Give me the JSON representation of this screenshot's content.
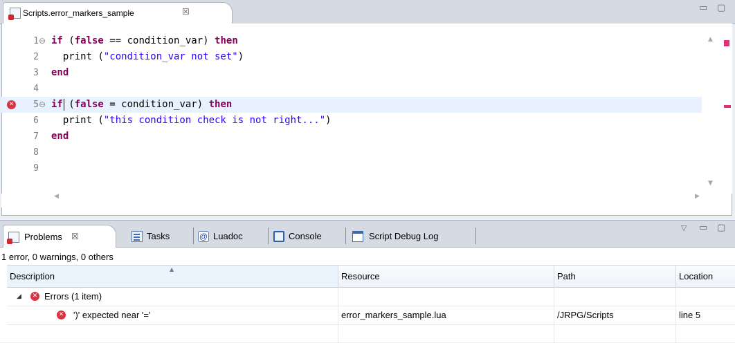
{
  "editor": {
    "tab_title": "Scripts.error_markers_sample",
    "tab_close": "☒",
    "lines": [
      {
        "num": "1",
        "fold": true,
        "tokens": [
          {
            "t": "if",
            "c": "kw"
          },
          {
            "t": " (",
            "c": ""
          },
          {
            "t": "false",
            "c": "kw"
          },
          {
            "t": " == condition_var) ",
            "c": ""
          },
          {
            "t": "then",
            "c": "kw"
          }
        ]
      },
      {
        "num": "2",
        "fold": false,
        "tokens": [
          {
            "t": "  print (",
            "c": ""
          },
          {
            "t": "\"condition_var not set\"",
            "c": "str"
          },
          {
            "t": ")",
            "c": ""
          }
        ]
      },
      {
        "num": "3",
        "fold": false,
        "tokens": [
          {
            "t": "end",
            "c": "kw"
          }
        ]
      },
      {
        "num": "4",
        "fold": false,
        "tokens": []
      },
      {
        "num": "5",
        "fold": true,
        "error": true,
        "highlight": true,
        "tokens": [
          {
            "t": "if",
            "c": "kw"
          },
          {
            "t": " (",
            "c": ""
          },
          {
            "t": "false",
            "c": "kw"
          },
          {
            "t": " = condition_var) ",
            "c": ""
          },
          {
            "t": "then",
            "c": "kw"
          }
        ]
      },
      {
        "num": "6",
        "fold": false,
        "tokens": [
          {
            "t": "  print (",
            "c": ""
          },
          {
            "t": "\"this condition check is not right...\"",
            "c": "str"
          },
          {
            "t": ")",
            "c": ""
          }
        ]
      },
      {
        "num": "7",
        "fold": false,
        "tokens": [
          {
            "t": "end",
            "c": "kw"
          }
        ]
      },
      {
        "num": "8",
        "fold": false,
        "tokens": []
      },
      {
        "num": "9",
        "fold": false,
        "tokens": []
      }
    ]
  },
  "panel": {
    "tabs": [
      {
        "label": "Problems",
        "icon": "problems-icon",
        "active": true
      },
      {
        "label": "Tasks",
        "icon": "tasks-icon",
        "active": false
      },
      {
        "label": "Luadoc",
        "icon": "luadoc-icon",
        "active": false
      },
      {
        "label": "Console",
        "icon": "console-icon",
        "active": false
      },
      {
        "label": "Script Debug Log",
        "icon": "debug-log-icon",
        "active": false
      }
    ],
    "close_glyph": "☒",
    "summary": "1 error, 0 warnings, 0 others",
    "columns": [
      "Description",
      "Resource",
      "Path",
      "Location"
    ],
    "group": {
      "label": "Errors (1 item)"
    },
    "rows": [
      {
        "description": "')' expected near '='",
        "resource": "error_markers_sample.lua",
        "path": "/JRPG/Scripts",
        "location": "line 5"
      }
    ]
  },
  "icons": {
    "minimize": "▭",
    "maximize": "▢",
    "view_menu": "▽",
    "error_mark": "✕",
    "fold_marker": "⊖"
  },
  "colors": {
    "keyword": "#7f0055",
    "string": "#2a00ff",
    "error": "#d9333f",
    "current_line": "#e8f2fe",
    "overview_marker": "#e0307a"
  }
}
